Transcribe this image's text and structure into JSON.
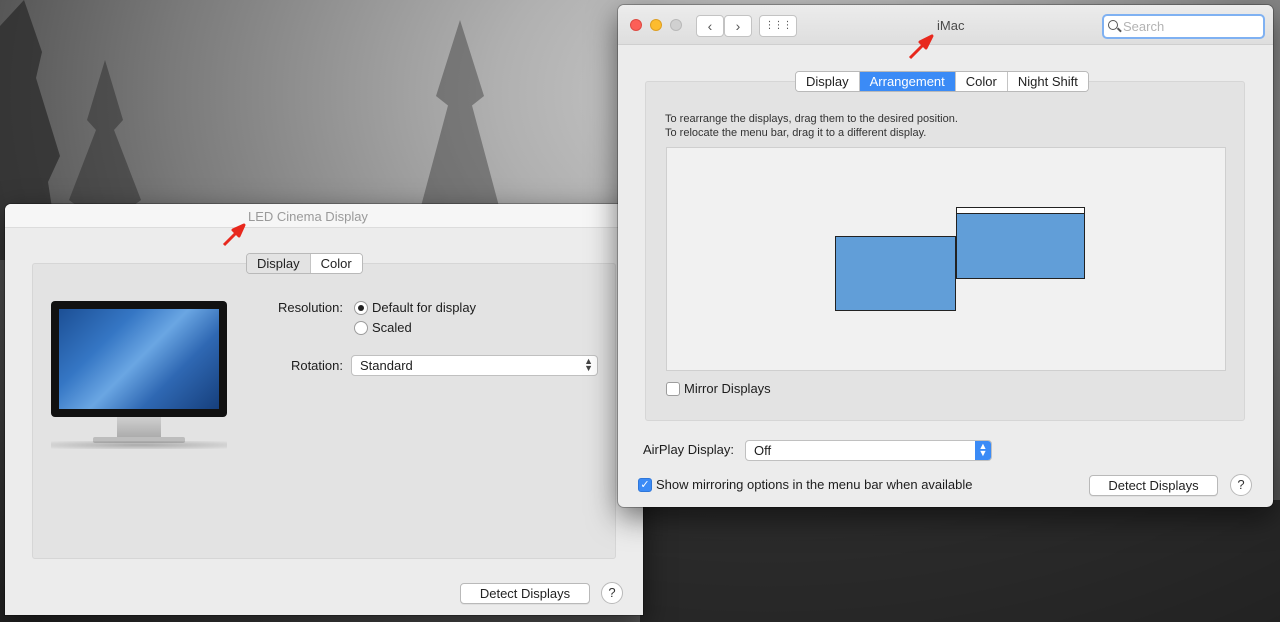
{
  "colors": {
    "accent": "#3b8bf6",
    "display_fill": "#619ed8",
    "annotation_arrow": "#e8281d"
  },
  "left_window": {
    "title": "LED Cinema Display",
    "tabs": [
      {
        "label": "Display",
        "selected": true
      },
      {
        "label": "Color",
        "selected": false
      }
    ],
    "image": "display-monitor-icon",
    "resolution": {
      "label": "Resolution:",
      "options": [
        {
          "label": "Default for display",
          "checked": true
        },
        {
          "label": "Scaled",
          "checked": false
        }
      ]
    },
    "rotation": {
      "label": "Rotation:",
      "value": "Standard"
    },
    "detect_button": "Detect Displays",
    "help_button": "?"
  },
  "right_window": {
    "title": "iMac",
    "nav": {
      "back": "‹",
      "forward": "›",
      "grid": "⋮⋮⋮"
    },
    "search": {
      "placeholder": "Search",
      "value": ""
    },
    "tabs": [
      {
        "label": "Display",
        "selected": false
      },
      {
        "label": "Arrangement",
        "selected": true
      },
      {
        "label": "Color",
        "selected": false
      },
      {
        "label": "Night Shift",
        "selected": false
      }
    ],
    "instructions": [
      "To rearrange the displays, drag them to the desired position.",
      "To relocate the menu bar, drag it to a different display."
    ],
    "mirror_displays": {
      "label": "Mirror Displays",
      "checked": false
    },
    "airplay": {
      "label": "AirPlay Display:",
      "value": "Off"
    },
    "show_mirroring": {
      "label": "Show mirroring options in the menu bar when available",
      "checked": true
    },
    "detect_button": "Detect Displays",
    "help_button": "?"
  }
}
